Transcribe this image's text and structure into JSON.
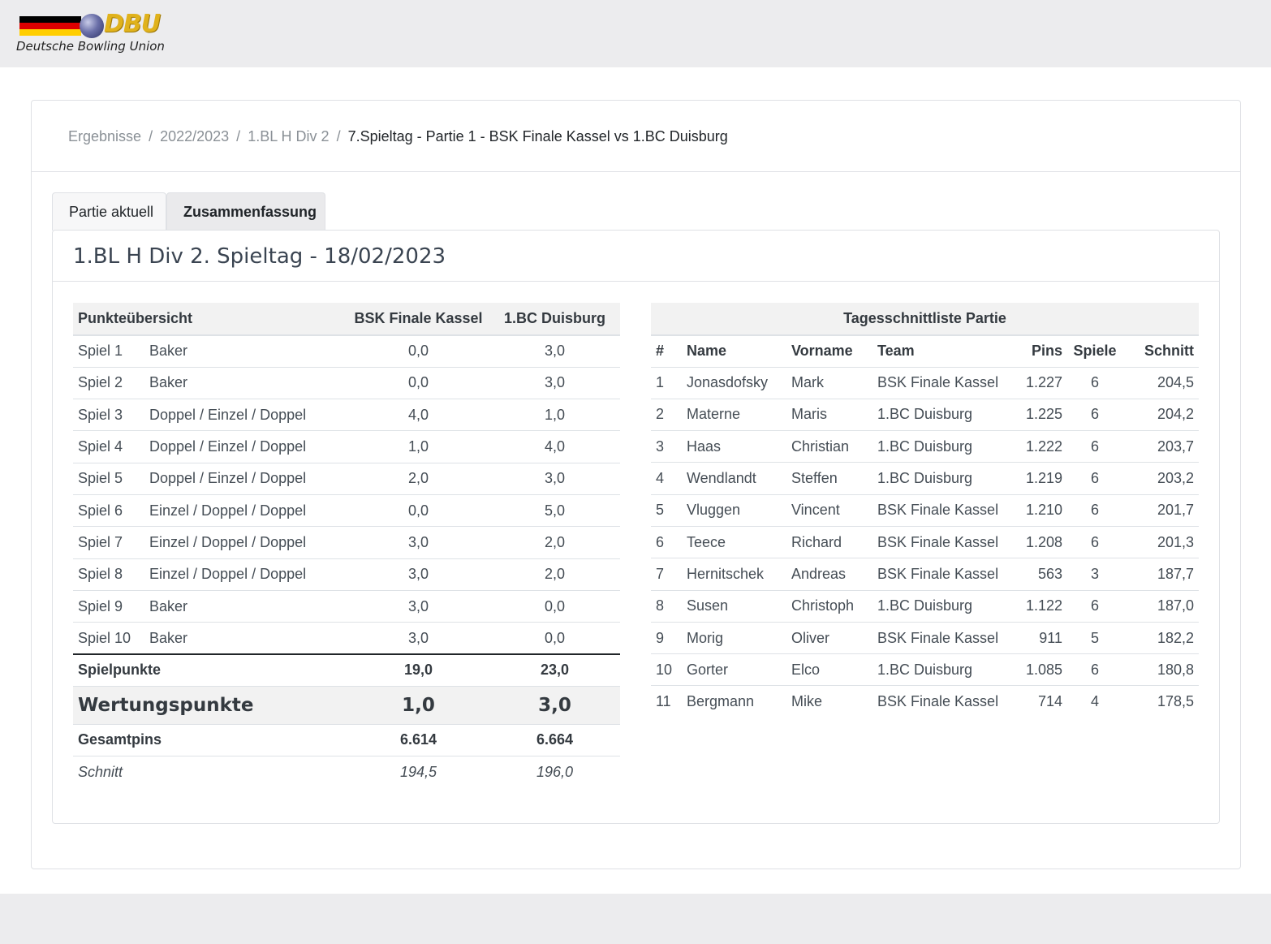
{
  "brand": {
    "logo_text": "DBU",
    "subtitle": "Deutsche Bowling Union",
    "flag_colors": [
      "#000000",
      "#dd0000",
      "#ffce00"
    ]
  },
  "breadcrumb": [
    {
      "label": "Ergebnisse"
    },
    {
      "label": "2022/2023"
    },
    {
      "label": "1.BL H Div 2"
    },
    {
      "label": "7.Spieltag - Partie 1 - BSK Finale Kassel vs 1.BC Duisburg"
    }
  ],
  "tabs": [
    {
      "label": "Partie aktuell",
      "active": false
    },
    {
      "label": "Zusammenfassung",
      "active": true
    }
  ],
  "panel_title": "1.BL H Div 2. Spieltag - 18/02/2023",
  "points": {
    "headers": {
      "title": "Punkteübersicht",
      "team1": "BSK Finale Kassel",
      "team2": "1.BC Duisburg"
    },
    "rows": [
      {
        "game": "Spiel 1",
        "format": "Baker",
        "t1": "0,0",
        "t2": "3,0"
      },
      {
        "game": "Spiel 2",
        "format": "Baker",
        "t1": "0,0",
        "t2": "3,0"
      },
      {
        "game": "Spiel 3",
        "format": "Doppel / Einzel / Doppel",
        "t1": "4,0",
        "t2": "1,0"
      },
      {
        "game": "Spiel 4",
        "format": "Doppel / Einzel / Doppel",
        "t1": "1,0",
        "t2": "4,0"
      },
      {
        "game": "Spiel 5",
        "format": "Doppel / Einzel / Doppel",
        "t1": "2,0",
        "t2": "3,0"
      },
      {
        "game": "Spiel 6",
        "format": "Einzel / Doppel / Doppel",
        "t1": "0,0",
        "t2": "5,0"
      },
      {
        "game": "Spiel 7",
        "format": "Einzel / Doppel / Doppel",
        "t1": "3,0",
        "t2": "2,0"
      },
      {
        "game": "Spiel 8",
        "format": "Einzel / Doppel / Doppel",
        "t1": "3,0",
        "t2": "2,0"
      },
      {
        "game": "Spiel 9",
        "format": "Baker",
        "t1": "3,0",
        "t2": "0,0"
      },
      {
        "game": "Spiel 10",
        "format": "Baker",
        "t1": "3,0",
        "t2": "0,0"
      }
    ],
    "spielpunkte": {
      "label": "Spielpunkte",
      "t1": "19,0",
      "t2": "23,0"
    },
    "wertungspunkte": {
      "label": "Wertungspunkte",
      "t1": "1,0",
      "t2": "3,0"
    },
    "gesamtpins": {
      "label": "Gesamtpins",
      "t1": "6.614",
      "t2": "6.664"
    },
    "schnitt": {
      "label": "Schnitt",
      "t1": "194,5",
      "t2": "196,0"
    }
  },
  "averages": {
    "caption": "Tagesschnittliste Partie",
    "headers": {
      "rank": "#",
      "name": "Name",
      "first": "Vorname",
      "team": "Team",
      "pins": "Pins",
      "games": "Spiele",
      "avg": "Schnitt"
    },
    "rows": [
      {
        "rank": "1",
        "name": "Jonasdofsky",
        "first": "Mark",
        "team": "BSK Finale Kassel",
        "pins": "1.227",
        "games": "6",
        "avg": "204,5"
      },
      {
        "rank": "2",
        "name": "Materne",
        "first": "Maris",
        "team": "1.BC Duisburg",
        "pins": "1.225",
        "games": "6",
        "avg": "204,2"
      },
      {
        "rank": "3",
        "name": "Haas",
        "first": "Christian",
        "team": "1.BC Duisburg",
        "pins": "1.222",
        "games": "6",
        "avg": "203,7"
      },
      {
        "rank": "4",
        "name": "Wendlandt",
        "first": "Steffen",
        "team": "1.BC Duisburg",
        "pins": "1.219",
        "games": "6",
        "avg": "203,2"
      },
      {
        "rank": "5",
        "name": "Vluggen",
        "first": "Vincent",
        "team": "BSK Finale Kassel",
        "pins": "1.210",
        "games": "6",
        "avg": "201,7"
      },
      {
        "rank": "6",
        "name": "Teece",
        "first": "Richard",
        "team": "BSK Finale Kassel",
        "pins": "1.208",
        "games": "6",
        "avg": "201,3"
      },
      {
        "rank": "7",
        "name": "Hernitschek",
        "first": "Andreas",
        "team": "BSK Finale Kassel",
        "pins": "563",
        "games": "3",
        "avg": "187,7"
      },
      {
        "rank": "8",
        "name": "Susen",
        "first": "Christoph",
        "team": "1.BC Duisburg",
        "pins": "1.122",
        "games": "6",
        "avg": "187,0"
      },
      {
        "rank": "9",
        "name": "Morig",
        "first": "Oliver",
        "team": "BSK Finale Kassel",
        "pins": "911",
        "games": "5",
        "avg": "182,2"
      },
      {
        "rank": "10",
        "name": "Gorter",
        "first": "Elco",
        "team": "1.BC Duisburg",
        "pins": "1.085",
        "games": "6",
        "avg": "180,8"
      },
      {
        "rank": "11",
        "name": "Bergmann",
        "first": "Mike",
        "team": "BSK Finale Kassel",
        "pins": "714",
        "games": "4",
        "avg": "178,5"
      }
    ]
  }
}
